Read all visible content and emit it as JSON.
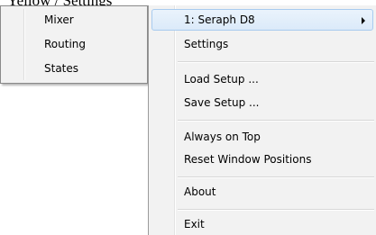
{
  "page_title": "Yellow / Settings",
  "submenu": {
    "items": [
      {
        "label": "Mixer"
      },
      {
        "label": "Routing"
      },
      {
        "label": "States"
      }
    ]
  },
  "menu": {
    "device_item": {
      "label": "1: Seraph D8",
      "icon": "chevron-right-icon"
    },
    "settings": {
      "label": "Settings"
    },
    "load_setup": {
      "label": "Load Setup ..."
    },
    "save_setup": {
      "label": "Save Setup ..."
    },
    "always_on_top": {
      "label": "Always on Top"
    },
    "reset_window_positions": {
      "label": "Reset Window Positions"
    },
    "about": {
      "label": "About"
    },
    "exit": {
      "label": "Exit"
    }
  },
  "colors": {
    "menu_background": "#f2f2f2",
    "highlight_background": "#dbeaf9",
    "highlight_border": "#a8cbef"
  }
}
